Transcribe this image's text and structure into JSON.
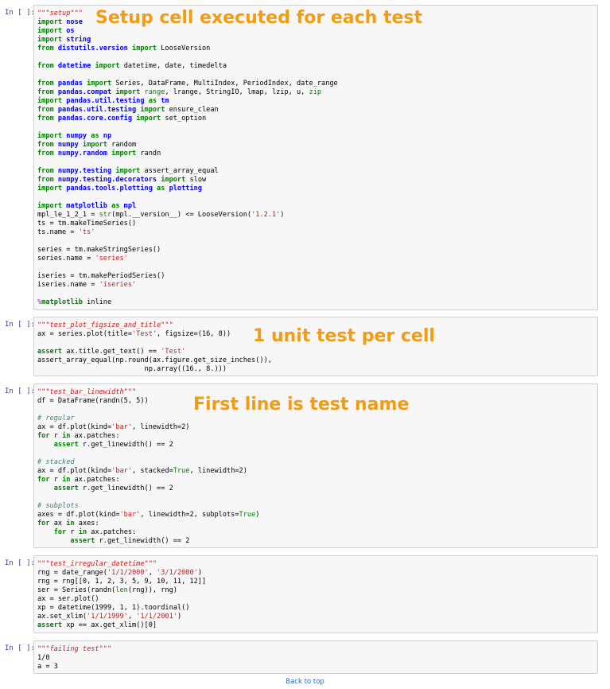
{
  "cells": [
    {
      "prompt": "In [ ]:",
      "annotation": "Setup cell executed for each test",
      "lines": [
        [
          [
            "ds",
            "\"\"\"setup\"\"\""
          ]
        ],
        [
          [
            "kw",
            "import "
          ],
          [
            "nm",
            "nose"
          ]
        ],
        [
          [
            "kw",
            "import "
          ],
          [
            "nm",
            "os"
          ]
        ],
        [
          [
            "kw",
            "import "
          ],
          [
            "nm",
            "string"
          ]
        ],
        [
          [
            "kw",
            "from "
          ],
          [
            "nm",
            "distutils.version"
          ],
          [
            "kw",
            " import "
          ],
          [
            "",
            "LooseVersion"
          ]
        ],
        [],
        [
          [
            "kw",
            "from "
          ],
          [
            "nm",
            "datetime"
          ],
          [
            "kw",
            " import "
          ],
          [
            "",
            "datetime, date, timedelta"
          ]
        ],
        [],
        [
          [
            "kw",
            "from "
          ],
          [
            "nm",
            "pandas"
          ],
          [
            "kw",
            " import "
          ],
          [
            "",
            "Series, DataFrame, MultiIndex, PeriodIndex, date_range"
          ]
        ],
        [
          [
            "kw",
            "from "
          ],
          [
            "nm",
            "pandas.compat"
          ],
          [
            "kw",
            " import "
          ],
          [
            "bi",
            "range"
          ],
          [
            "",
            ", lrange, StringIO, lmap, lzip, u, "
          ],
          [
            "bi",
            "zip"
          ]
        ],
        [
          [
            "kw",
            "import "
          ],
          [
            "nm",
            "pandas.util.testing"
          ],
          [
            "kw",
            " as "
          ],
          [
            "nm",
            "tm"
          ]
        ],
        [
          [
            "kw",
            "from "
          ],
          [
            "nm",
            "pandas.util.testing"
          ],
          [
            "kw",
            " import "
          ],
          [
            "",
            "ensure_clean"
          ]
        ],
        [
          [
            "kw",
            "from "
          ],
          [
            "nm",
            "pandas.core.config"
          ],
          [
            "kw",
            " import "
          ],
          [
            "",
            "set_option"
          ]
        ],
        [],
        [
          [
            "kw",
            "import "
          ],
          [
            "nm",
            "numpy"
          ],
          [
            "kw",
            " as "
          ],
          [
            "nm",
            "np"
          ]
        ],
        [
          [
            "kw",
            "from "
          ],
          [
            "nm",
            "numpy"
          ],
          [
            "kw",
            " import "
          ],
          [
            "",
            "random"
          ]
        ],
        [
          [
            "kw",
            "from "
          ],
          [
            "nm",
            "numpy.random"
          ],
          [
            "kw",
            " import "
          ],
          [
            "",
            "randn"
          ]
        ],
        [],
        [
          [
            "kw",
            "from "
          ],
          [
            "nm",
            "numpy.testing"
          ],
          [
            "kw",
            " import "
          ],
          [
            "",
            "assert_array_equal"
          ]
        ],
        [
          [
            "kw",
            "from "
          ],
          [
            "nm",
            "numpy.testing.decorators"
          ],
          [
            "kw",
            " import "
          ],
          [
            "",
            "slow"
          ]
        ],
        [
          [
            "kw",
            "import "
          ],
          [
            "nm",
            "pandas.tools.plotting"
          ],
          [
            "kw",
            " as "
          ],
          [
            "nm",
            "plotting"
          ]
        ],
        [],
        [
          [
            "kw",
            "import "
          ],
          [
            "nm",
            "matplotlib"
          ],
          [
            "kw",
            " as "
          ],
          [
            "nm",
            "mpl"
          ]
        ],
        [
          [
            "",
            "mpl_le_1_2_1 = "
          ],
          [
            "bi",
            "str"
          ],
          [
            "",
            "(mpl.__version__) <= LooseVersion("
          ],
          [
            "st",
            "'1.2.1'"
          ],
          [
            "",
            ")"
          ]
        ],
        [
          [
            "",
            "ts = tm.makeTimeSeries()"
          ]
        ],
        [
          [
            "",
            "ts.name = "
          ],
          [
            "st",
            "'ts'"
          ]
        ],
        [],
        [
          [
            "",
            "series = tm.makeStringSeries()"
          ]
        ],
        [
          [
            "",
            "series.name = "
          ],
          [
            "st",
            "'series'"
          ]
        ],
        [],
        [
          [
            "",
            "iseries = tm.makePeriodSeries()"
          ]
        ],
        [
          [
            "",
            "iseries.name = "
          ],
          [
            "st",
            "'iseries'"
          ]
        ],
        [],
        [
          [
            "mg",
            "%"
          ],
          [
            "kw",
            "matplotlib"
          ],
          [
            "",
            " inline"
          ]
        ]
      ]
    },
    {
      "prompt": "In [ ]:",
      "annotation": "1 unit test per cell",
      "lines": [
        [
          [
            "ds",
            "\"\"\"test_plot_figsize_and_title\"\"\""
          ]
        ],
        [
          [
            "",
            "ax = series.plot(title="
          ],
          [
            "st",
            "'Test'"
          ],
          [
            "",
            ", figsize=(16, 8))"
          ]
        ],
        [],
        [
          [
            "kw",
            "assert "
          ],
          [
            "",
            "ax.title.get_text() == "
          ],
          [
            "st",
            "'Test'"
          ]
        ],
        [
          [
            "",
            "assert_array_equal(np.round(ax.figure.get_size_inches()),"
          ]
        ],
        [
          [
            "",
            "                          np.array((16., 8.)))"
          ]
        ]
      ]
    },
    {
      "prompt": "In [ ]:",
      "annotation": "First line is test name",
      "lines": [
        [
          [
            "ds",
            "\"\"\"test_bar_linewidth\"\"\""
          ]
        ],
        [
          [
            "",
            "df = DataFrame(randn(5, 5))"
          ]
        ],
        [],
        [
          [
            "cm",
            "# regular"
          ]
        ],
        [
          [
            "",
            "ax = df.plot(kind="
          ],
          [
            "st",
            "'bar'"
          ],
          [
            "",
            ", linewidth=2)"
          ]
        ],
        [
          [
            "kw",
            "for "
          ],
          [
            "",
            "r "
          ],
          [
            "kw",
            "in "
          ],
          [
            "",
            "ax.patches:"
          ]
        ],
        [
          [
            "",
            "    "
          ],
          [
            "kw",
            "assert "
          ],
          [
            "",
            "r.get_linewidth() == 2"
          ]
        ],
        [],
        [
          [
            "cm",
            "# stacked"
          ]
        ],
        [
          [
            "",
            "ax = df.plot(kind="
          ],
          [
            "st",
            "'bar'"
          ],
          [
            "",
            ", stacked="
          ],
          [
            "bi",
            "True"
          ],
          [
            "",
            ", linewidth=2)"
          ]
        ],
        [
          [
            "kw",
            "for "
          ],
          [
            "",
            "r "
          ],
          [
            "kw",
            "in "
          ],
          [
            "",
            "ax.patches:"
          ]
        ],
        [
          [
            "",
            "    "
          ],
          [
            "kw",
            "assert "
          ],
          [
            "",
            "r.get_linewidth() == 2"
          ]
        ],
        [],
        [
          [
            "cm",
            "# subplots"
          ]
        ],
        [
          [
            "",
            "axes = df.plot(kind="
          ],
          [
            "st",
            "'bar'"
          ],
          [
            "",
            ", linewidth=2, subplots="
          ],
          [
            "bi",
            "True"
          ],
          [
            "",
            ")"
          ]
        ],
        [
          [
            "kw",
            "for "
          ],
          [
            "",
            "ax "
          ],
          [
            "kw",
            "in "
          ],
          [
            "",
            "axes:"
          ]
        ],
        [
          [
            "",
            "    "
          ],
          [
            "kw",
            "for "
          ],
          [
            "",
            "r "
          ],
          [
            "kw",
            "in "
          ],
          [
            "",
            "ax.patches:"
          ]
        ],
        [
          [
            "",
            "        "
          ],
          [
            "kw",
            "assert "
          ],
          [
            "",
            "r.get_linewidth() == 2"
          ]
        ]
      ]
    },
    {
      "prompt": "In [ ]:",
      "annotation": "",
      "lines": [
        [
          [
            "ds",
            "\"\"\"test_irregular_datetime\"\"\""
          ]
        ],
        [
          [
            "",
            "rng = date_range("
          ],
          [
            "st",
            "'1/1/2000'"
          ],
          [
            "",
            ", "
          ],
          [
            "st",
            "'3/1/2000'"
          ],
          [
            "",
            ")"
          ]
        ],
        [
          [
            "",
            "rng = rng[[0, 1, 2, 3, 5, 9, 10, 11, 12]]"
          ]
        ],
        [
          [
            "",
            "ser = Series(randn("
          ],
          [
            "bi",
            "len"
          ],
          [
            "",
            "(rng)), rng)"
          ]
        ],
        [
          [
            "",
            "ax = ser.plot()"
          ]
        ],
        [
          [
            "",
            "xp = datetime(1999, 1, 1).toordinal()"
          ]
        ],
        [
          [
            "",
            "ax.set_xlim("
          ],
          [
            "st",
            "'1/1/1999'"
          ],
          [
            "",
            ", "
          ],
          [
            "st",
            "'1/1/2001'"
          ],
          [
            "",
            ")"
          ]
        ],
        [
          [
            "kw",
            "assert "
          ],
          [
            "",
            "xp == ax.get_xlim()[0]"
          ]
        ]
      ]
    },
    {
      "prompt": "In [ ]:",
      "annotation": "",
      "lines": [
        [
          [
            "ds",
            "\"\"\"failing test\"\"\""
          ]
        ],
        [
          [
            "",
            "1/0"
          ]
        ],
        [
          [
            "",
            "a = 3"
          ]
        ]
      ]
    }
  ],
  "footer": {
    "back_to_top": "Back to top"
  }
}
